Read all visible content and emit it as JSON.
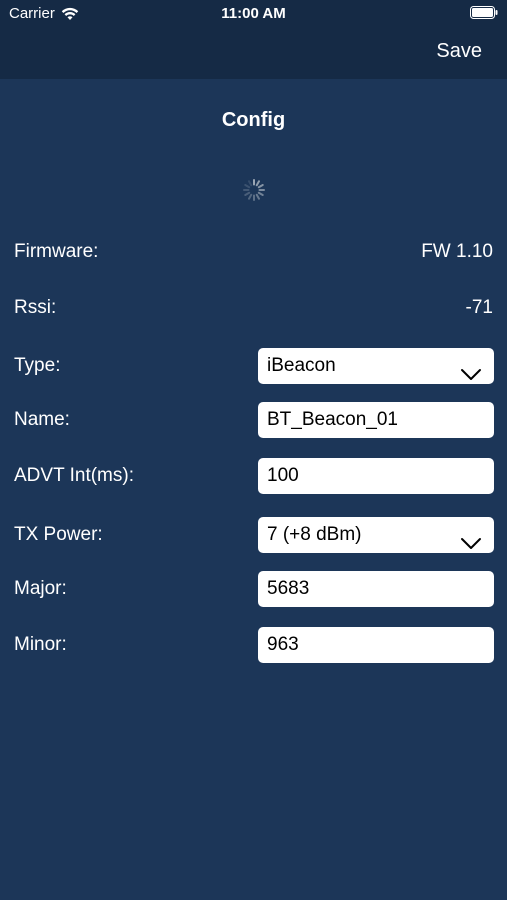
{
  "status_bar": {
    "carrier": "Carrier",
    "time": "11:00 AM",
    "wifi_icon": "wifi-icon",
    "battery_icon": "battery-icon"
  },
  "nav": {
    "save_label": "Save"
  },
  "page": {
    "title": "Config",
    "spinner_icon": "spinner-icon"
  },
  "info": {
    "firmware_label": "Firmware:",
    "firmware_value": "FW 1.10",
    "rssi_label": "Rssi:",
    "rssi_value": "-71"
  },
  "form": {
    "type_label": "Type:",
    "type_value": "iBeacon",
    "name_label": "Name:",
    "name_value": "BT_Beacon_01",
    "advt_label": "ADVT Int(ms):",
    "advt_value": "100",
    "tx_label": "TX Power:",
    "tx_value": "7 (+8 dBm)",
    "major_label": "Major:",
    "major_value": "5683",
    "minor_label": "Minor:",
    "minor_value": "963"
  },
  "colors": {
    "background": "#1c3658",
    "nav_background": "#152a45",
    "field_background": "#ffffff"
  }
}
